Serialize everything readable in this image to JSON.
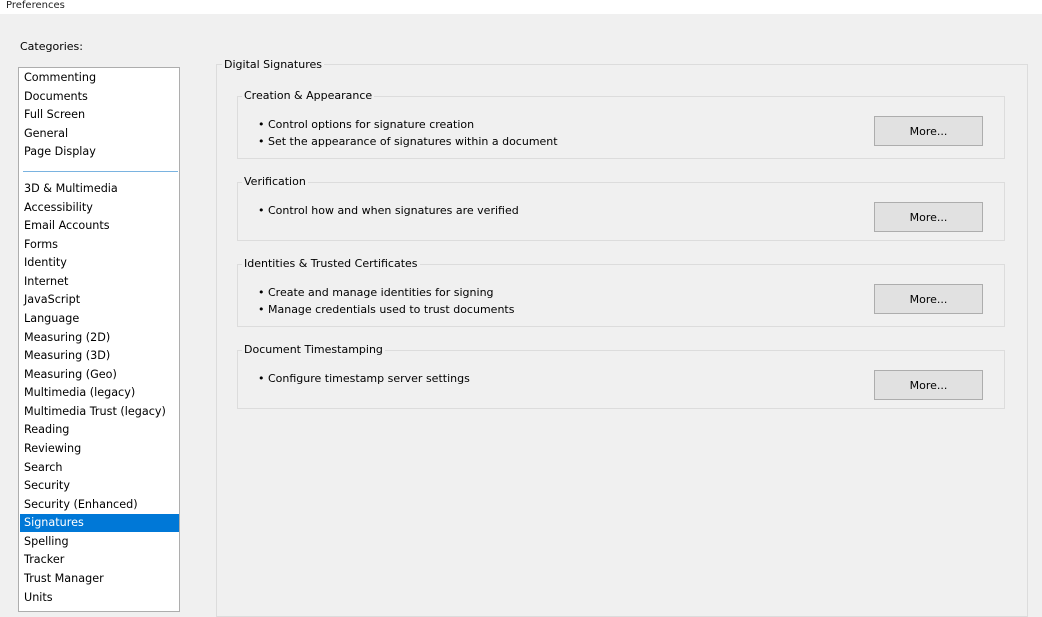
{
  "window": {
    "title": "Preferences"
  },
  "categories": {
    "label": "Categories:",
    "top_group": [
      "Commenting",
      "Documents",
      "Full Screen",
      "General",
      "Page Display"
    ],
    "items": [
      "3D & Multimedia",
      "Accessibility",
      "Email Accounts",
      "Forms",
      "Identity",
      "Internet",
      "JavaScript",
      "Language",
      "Measuring (2D)",
      "Measuring (3D)",
      "Measuring (Geo)",
      "Multimedia (legacy)",
      "Multimedia Trust (legacy)",
      "Reading",
      "Reviewing",
      "Search",
      "Security",
      "Security (Enhanced)",
      "Signatures",
      "Spelling",
      "Tracker",
      "Trust Manager",
      "Units"
    ],
    "selected": "Signatures"
  },
  "main": {
    "title": "Digital Signatures",
    "groups": [
      {
        "title": "Creation & Appearance",
        "bullets": [
          "• Control options for signature creation",
          "• Set the appearance of signatures within a document"
        ],
        "button": "More..."
      },
      {
        "title": "Verification",
        "bullets": [
          "• Control how and when signatures are verified"
        ],
        "button": "More..."
      },
      {
        "title": "Identities & Trusted Certificates",
        "bullets": [
          "• Create and manage identities for signing",
          "• Manage credentials used to trust documents"
        ],
        "button": "More..."
      },
      {
        "title": "Document Timestamping",
        "bullets": [
          "• Configure timestamp server settings"
        ],
        "button": "More..."
      }
    ]
  },
  "colors": {
    "selection": "#0078d7",
    "divider": "#7ab3e0",
    "background": "#f0f0f0"
  },
  "icons": []
}
